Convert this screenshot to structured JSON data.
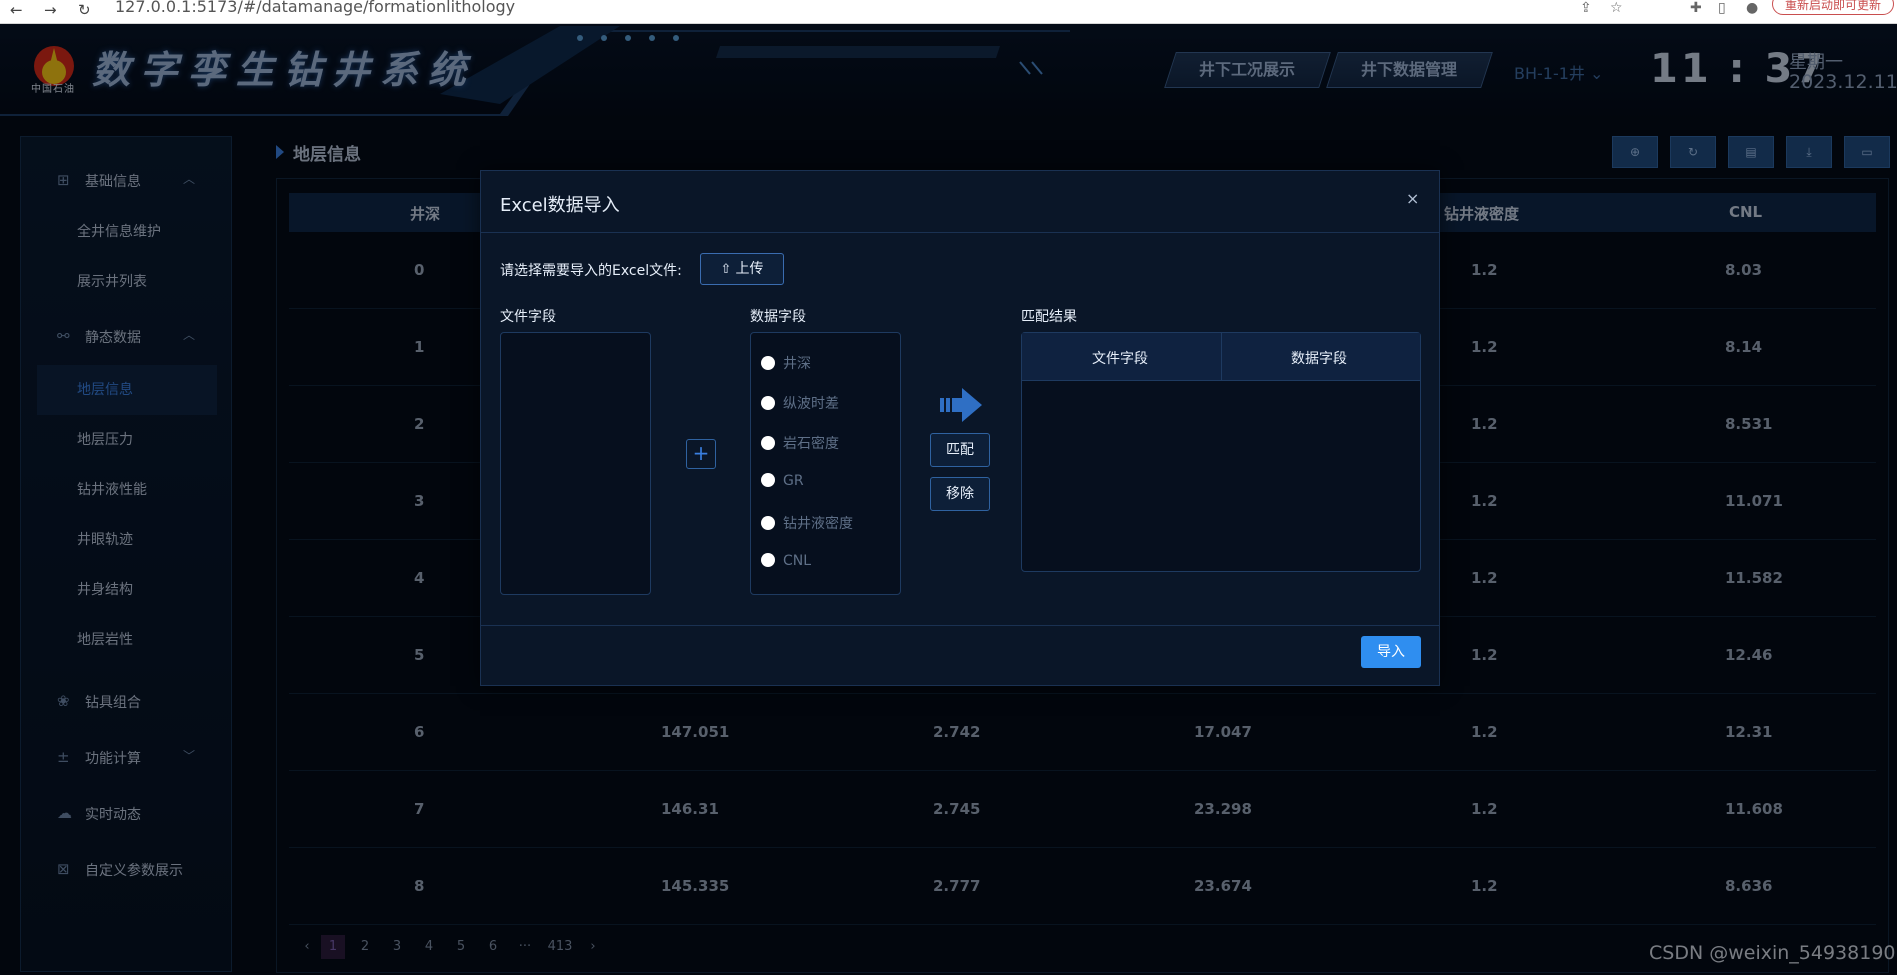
{
  "browser": {
    "url": "127.0.0.1:5173/#/datamanage/formationlithology",
    "update_label": "重新启动即可更新"
  },
  "header": {
    "logo_text": "中国石油",
    "app_title": "数字孪生钻井系统",
    "nav_buttons": [
      "井下工况展示",
      "井下数据管理"
    ],
    "well_select": "BH-1-1井",
    "time": "11 : 37",
    "weekday": "星期一",
    "date": "2023.12.11"
  },
  "sidebar": {
    "groups": [
      {
        "label": "基础信息",
        "icon": "grid-icon"
      },
      {
        "label": "静态数据",
        "icon": "share-icon"
      },
      {
        "label": "钻具组合",
        "icon": "rings-icon"
      },
      {
        "label": "功能计算",
        "icon": "calculator-icon"
      },
      {
        "label": "实时动态",
        "icon": "cloud-icon"
      },
      {
        "label": "自定义参数展示",
        "icon": "settings-grid-icon"
      }
    ],
    "items": [
      "全井信息维护",
      "展示井列表",
      "地层信息",
      "地层压力",
      "钻井液性能",
      "井眼轨迹",
      "井身结构",
      "地层岩性"
    ],
    "active_item": "地层信息"
  },
  "main": {
    "breadcrumb": "地层信息",
    "toolbar_icons": [
      "add-icon",
      "refresh-icon",
      "document-icon",
      "download-icon",
      "folder-icon"
    ],
    "table": {
      "columns": [
        "井深",
        "",
        "",
        "",
        "钻井液密度",
        "CNL"
      ],
      "rows": [
        [
          "0",
          "",
          "",
          "",
          "1.2",
          "8.03"
        ],
        [
          "1",
          "",
          "",
          "",
          "1.2",
          "8.14"
        ],
        [
          "2",
          "",
          "",
          "",
          "1.2",
          "8.531"
        ],
        [
          "3",
          "",
          "",
          "",
          "1.2",
          "11.071"
        ],
        [
          "4",
          "",
          "",
          "",
          "1.2",
          "11.582"
        ],
        [
          "5",
          "",
          "",
          "",
          "1.2",
          "12.46"
        ],
        [
          "6",
          "147.051",
          "2.742",
          "17.047",
          "1.2",
          "12.31"
        ],
        [
          "7",
          "146.31",
          "2.745",
          "23.298",
          "1.2",
          "11.608"
        ],
        [
          "8",
          "145.335",
          "2.777",
          "23.674",
          "1.2",
          "8.636"
        ]
      ]
    },
    "pagination": {
      "prev": "‹",
      "pages": [
        "1",
        "2",
        "3",
        "4",
        "5",
        "6",
        "···",
        "413"
      ],
      "next": "›",
      "current": "1"
    }
  },
  "modal": {
    "title": "Excel数据导入",
    "close": "×",
    "upload_label": "请选择需要导入的Excel文件:",
    "upload_button": "上传",
    "file_fields_label": "文件字段",
    "data_fields_label": "数据字段",
    "data_fields": [
      "井深",
      "纵波时差",
      "岩石密度",
      "GR",
      "钻井液密度",
      "CNL"
    ],
    "match_button": "匹配",
    "remove_button": "移除",
    "add_button": "+",
    "result_label": "匹配结果",
    "result_columns": [
      "文件字段",
      "数据字段"
    ],
    "import_button": "导入"
  },
  "watermark": "CSDN @weixin_54938190",
  "colors": {
    "accent": "#3a7fe0",
    "import_button": "#2f8ef0",
    "background": "#040b18"
  }
}
